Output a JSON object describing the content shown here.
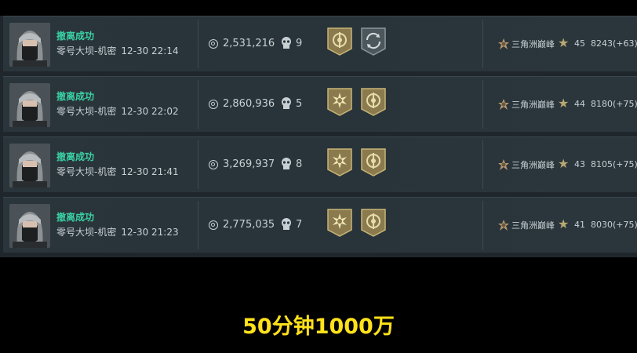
{
  "records": [
    {
      "status": "撤离成功",
      "map": "零号大坝-机密",
      "time": "12-30 22:14",
      "money": "2,531,216",
      "kills": "9",
      "badge1": "gold-emblem-icon",
      "badge2": "refresh-emblem-icon",
      "rank_name": "三角洲巅峰",
      "level": "45",
      "score": "8243",
      "delta": "(+63)"
    },
    {
      "status": "撤离成功",
      "map": "零号大坝-机密",
      "time": "12-30 22:02",
      "money": "2,860,936",
      "kills": "5",
      "badge1": "sun-emblem-icon",
      "badge2": "gold-emblem-icon",
      "rank_name": "三角洲巅峰",
      "level": "44",
      "score": "8180",
      "delta": "(+75)"
    },
    {
      "status": "撤离成功",
      "map": "零号大坝-机密",
      "time": "12-30 21:41",
      "money": "3,269,937",
      "kills": "8",
      "badge1": "sun-emblem-icon",
      "badge2": "gold-emblem-icon",
      "rank_name": "三角洲巅峰",
      "level": "43",
      "score": "8105",
      "delta": "(+75)"
    },
    {
      "status": "撤离成功",
      "map": "零号大坝-机密",
      "time": "12-30 21:23",
      "money": "2,775,035",
      "kills": "7",
      "badge1": "sun-emblem-icon",
      "badge2": "gold-emblem-icon",
      "rank_name": "三角洲巅峰",
      "level": "41",
      "score": "8030",
      "delta": "(+75)"
    }
  ],
  "caption": "50分钟1000万",
  "colors": {
    "status": "#3ad0a4",
    "caption": "#ffe11a",
    "panel": "#1f272c"
  }
}
